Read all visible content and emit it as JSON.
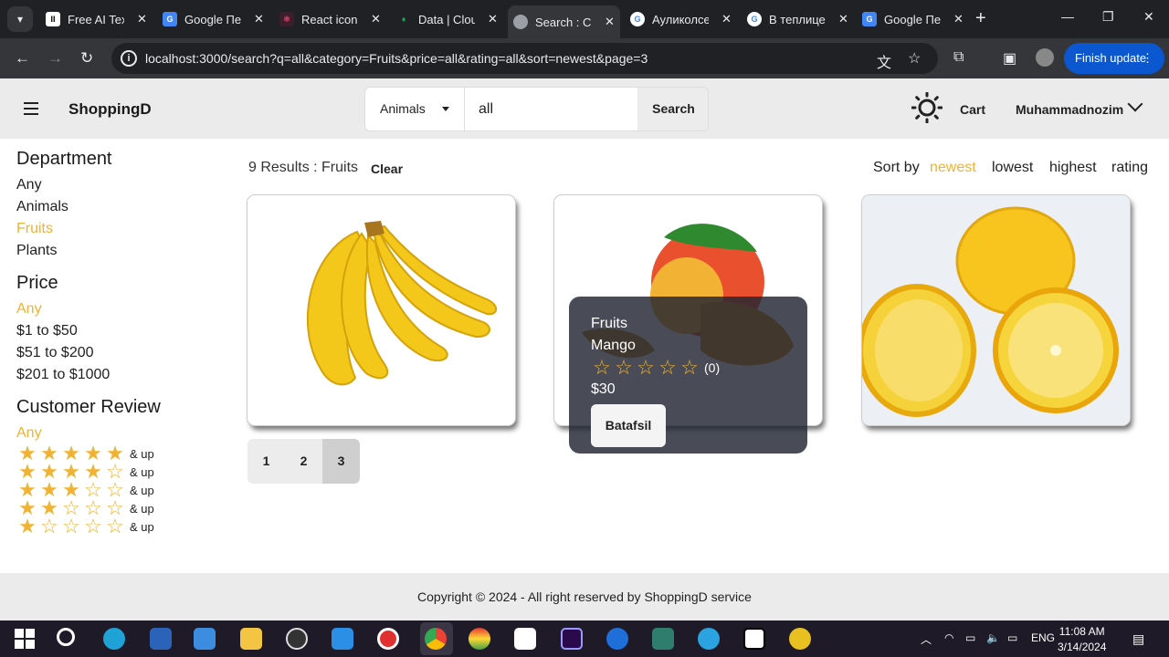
{
  "browser": {
    "tabs": [
      {
        "title": "Free AI Tex",
        "color": "#ffffff",
        "glyph": "II"
      },
      {
        "title": "Google Пе",
        "color": "#4285f4",
        "glyph": "G"
      },
      {
        "title": "React icon",
        "color": "#e53e6b",
        "glyph": "⚛"
      },
      {
        "title": "Data | Clou",
        "color": "#13aa52",
        "glyph": "♦"
      },
      {
        "title": "Search : Ca",
        "color": "#9aa0a6",
        "glyph": "◎"
      },
      {
        "title": "Ауликолсе",
        "color": "#ffffff",
        "glyph": "G"
      },
      {
        "title": "В теплице",
        "color": "#ffffff",
        "glyph": "G"
      },
      {
        "title": "Google Пе",
        "color": "#4285f4",
        "glyph": "G"
      }
    ],
    "url": "localhost:3000/search?q=all&category=Fruits&price=all&rating=all&sort=newest&page=3",
    "finish_update": "Finish update"
  },
  "header": {
    "brand": "ShoppingD",
    "category": "Animals",
    "query": "all",
    "search_label": "Search",
    "cart": "Cart",
    "user": "Muhammadnozim"
  },
  "sidebar": {
    "department_title": "Department",
    "departments": [
      "Any",
      "Animals",
      "Fruits",
      "Plants"
    ],
    "price_title": "Price",
    "prices": [
      "Any",
      "$1 to $50",
      "$51 to $200",
      "$201 to $1000"
    ],
    "review_title": "Customer Review",
    "review_any": "Any",
    "rating_rows": [
      5,
      4,
      3,
      2,
      1
    ],
    "and_up": "& up"
  },
  "results": {
    "summary": "9 Results : Fruits",
    "clear": "Clear",
    "sort_by": "Sort by",
    "sort_options": [
      "newest",
      "lowest",
      "highest",
      "rating"
    ],
    "active_sort": "newest"
  },
  "popup": {
    "category": "Fruits",
    "name": "Mango",
    "rating": 0,
    "reviews": "(0)",
    "price": "$30",
    "button": "Batafsil"
  },
  "pagination": [
    "1",
    "2",
    "3"
  ],
  "active_page": "3",
  "footer": "Copyright © 2024 - All right reserved by ShoppingD service",
  "taskbar": {
    "lang": "ENG",
    "time": "11:08 AM",
    "date": "3/14/2024"
  },
  "colors": {
    "accent": "#f0b233"
  }
}
